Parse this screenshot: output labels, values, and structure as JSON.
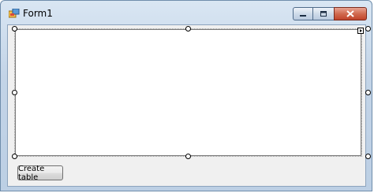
{
  "window": {
    "title": "Form1"
  },
  "buttons": {
    "create_table_label": "Create table"
  }
}
